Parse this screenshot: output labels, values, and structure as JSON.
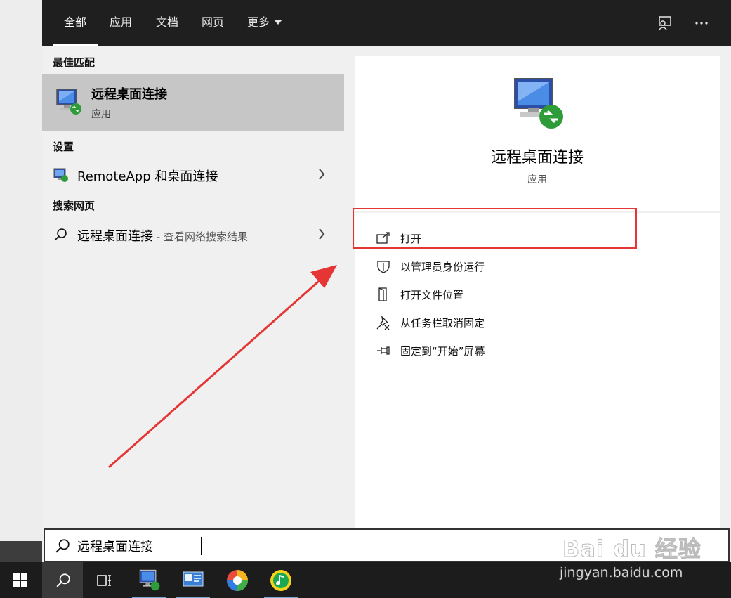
{
  "tabs": [
    {
      "label": "全部",
      "active": true
    },
    {
      "label": "应用"
    },
    {
      "label": "文档"
    },
    {
      "label": "网页"
    },
    {
      "label": "更多"
    }
  ],
  "top_icons": [
    "feedback-icon",
    "more-options-icon"
  ],
  "left": {
    "best_match_title": "最佳匹配",
    "best_match": {
      "name": "远程桌面连接",
      "type": "应用",
      "icon": "remote-desktop-icon"
    },
    "settings_title": "设置",
    "settings_item": {
      "label": "RemoteApp 和桌面连接",
      "icon": "remoteapp-icon"
    },
    "web_title": "搜索网页",
    "web_item": {
      "label": "远程桌面连接",
      "sub": " - 查看网络搜索结果",
      "icon": "search-icon"
    }
  },
  "right": {
    "app_name": "远程桌面连接",
    "app_type": "应用",
    "actions": [
      {
        "label": "打开",
        "icon": "open-icon"
      },
      {
        "label": "以管理员身份运行",
        "icon": "shield-icon"
      },
      {
        "label": "打开文件位置",
        "icon": "file-location-icon"
      },
      {
        "label": "从任务栏取消固定",
        "icon": "unpin-icon"
      },
      {
        "label": "固定到“开始”屏幕",
        "icon": "pin-icon"
      }
    ]
  },
  "search": {
    "value": "远程桌面连接"
  },
  "taskbar": [
    "start-icon",
    "search-icon",
    "task-view-icon",
    "remote-desktop-icon",
    "control-panel-icon",
    "photo-app-icon",
    "music-app-icon"
  ],
  "watermark": {
    "brand": "Bai du 经验",
    "url": "jingyan.baidu.com"
  },
  "colors": {
    "accent_red": "#e53535",
    "topbar": "#1f1f1f",
    "selected": "#c6c6c6"
  }
}
